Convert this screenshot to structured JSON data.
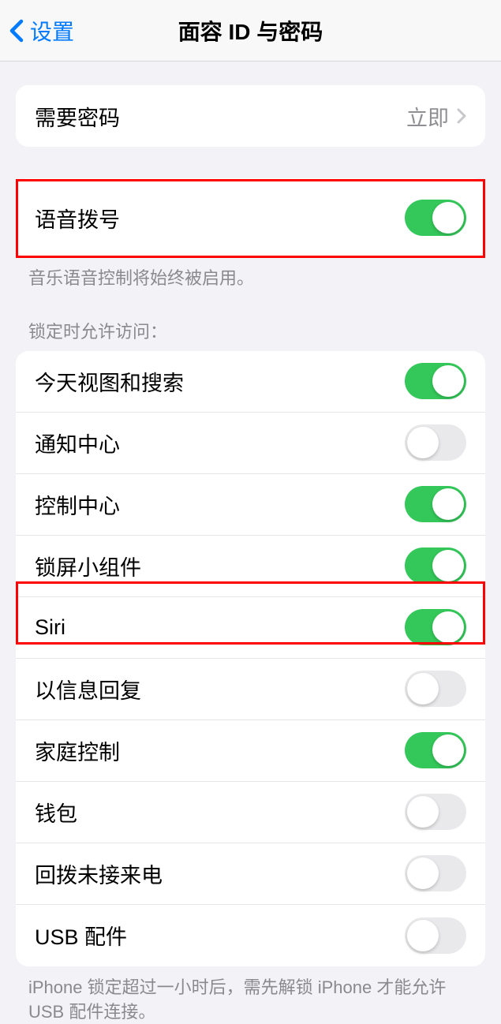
{
  "nav": {
    "back_label": "设置",
    "title": "面容 ID 与密码"
  },
  "passcode_row": {
    "label": "需要密码",
    "value": "立即"
  },
  "voice_dial": {
    "label": "语音拨号",
    "footer": "音乐语音控制将始终被启用。"
  },
  "lock_header": "锁定时允许访问：",
  "lock_items": [
    {
      "label": "今天视图和搜索",
      "on": true
    },
    {
      "label": "通知中心",
      "on": false
    },
    {
      "label": "控制中心",
      "on": true
    },
    {
      "label": "锁屏小组件",
      "on": true
    },
    {
      "label": "Siri",
      "on": true
    },
    {
      "label": "以信息回复",
      "on": false
    },
    {
      "label": "家庭控制",
      "on": true
    },
    {
      "label": "钱包",
      "on": false
    },
    {
      "label": "回拨未接来电",
      "on": false
    },
    {
      "label": "USB 配件",
      "on": false
    }
  ],
  "usb_footer": "iPhone 锁定超过一小时后，需先解锁 iPhone 才能允许 USB 配件连接。"
}
